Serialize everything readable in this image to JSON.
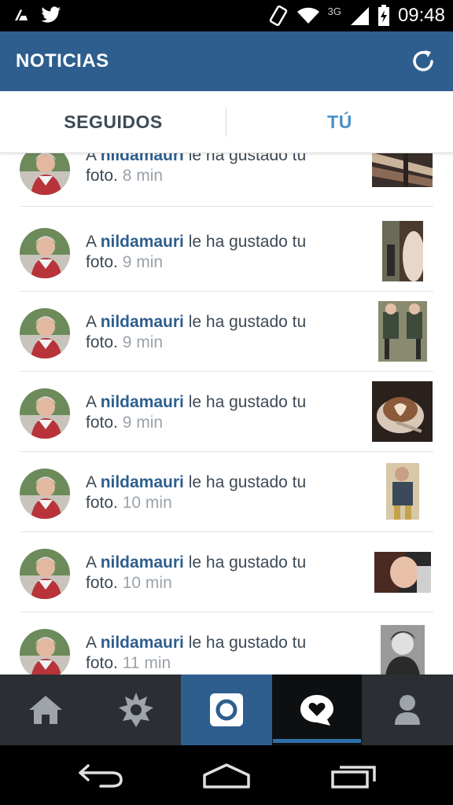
{
  "status_bar": {
    "left_icons": [
      "cleaner-icon",
      "twitter-icon"
    ],
    "right_icons": [
      "vibrate-icon",
      "wifi-icon",
      "signal-icon",
      "battery-charging-icon"
    ],
    "network": "3G",
    "time": "09:48"
  },
  "header": {
    "title": "NOTICIAS",
    "refresh_icon": "refresh-icon"
  },
  "tabs": [
    {
      "label": "SEGUIDOS",
      "active": false
    },
    {
      "label": "TÚ",
      "active": true
    }
  ],
  "colors": {
    "brand": "#2e5e8e",
    "active_tab": "#4a90c8",
    "text": "#3d4a56",
    "muted": "#9aa3ab"
  },
  "notifications": [
    {
      "prefix": "A ",
      "user": "nildamauri",
      "action": " le ha gustado tu",
      "line2": "foto.",
      "time": "8 min"
    },
    {
      "prefix": "A ",
      "user": "nildamauri",
      "action": " le ha gustado tu",
      "line2": "foto.",
      "time": "9 min"
    },
    {
      "prefix": "A ",
      "user": "nildamauri",
      "action": " le ha gustado tu",
      "line2": "foto.",
      "time": "9 min"
    },
    {
      "prefix": "A ",
      "user": "nildamauri",
      "action": " le ha gustado tu",
      "line2": "foto.",
      "time": "9 min"
    },
    {
      "prefix": "A ",
      "user": "nildamauri",
      "action": " le ha gustado tu",
      "line2": "foto.",
      "time": "10 min"
    },
    {
      "prefix": "A ",
      "user": "nildamauri",
      "action": " le ha gustado tu",
      "line2": "foto.",
      "time": "10 min"
    },
    {
      "prefix": "A ",
      "user": "nildamauri",
      "action": " le ha gustado tu",
      "line2": "foto.",
      "time": "11 min"
    }
  ],
  "bottom_nav": [
    {
      "icon": "home-icon",
      "active": false
    },
    {
      "icon": "explore-icon",
      "active": false
    },
    {
      "icon": "camera-icon",
      "active": false
    },
    {
      "icon": "activity-heart-icon",
      "active": true
    },
    {
      "icon": "profile-icon",
      "active": false
    }
  ],
  "system_nav": [
    "back-icon",
    "home-outline-icon",
    "recent-apps-icon"
  ]
}
